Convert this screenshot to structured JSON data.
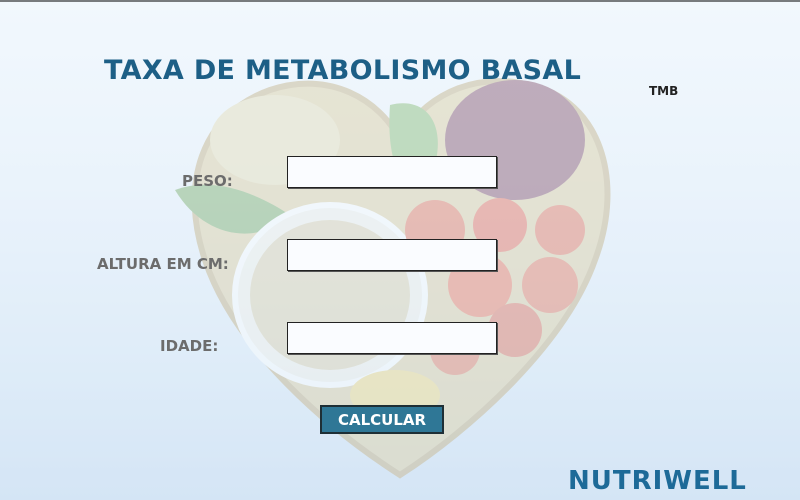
{
  "app": {
    "title": "TAXA DE METABOLISMO BASAL",
    "subtitle": "TMB",
    "brand": "NUTRIWELL"
  },
  "form": {
    "peso": {
      "label": "PESO:",
      "value": ""
    },
    "altura": {
      "label": "ALTURA EM CM:",
      "value": ""
    },
    "idade": {
      "label": "IDADE:",
      "value": ""
    }
  },
  "actions": {
    "calcular_label": "CALCULAR"
  },
  "colors": {
    "title": "#1d5f86",
    "brand": "#1d6a98",
    "button": "#2f7796",
    "label": "#6c6c6c"
  },
  "background": {
    "image": "heart-shaped-bowl-of-vegetables-and-grains"
  }
}
